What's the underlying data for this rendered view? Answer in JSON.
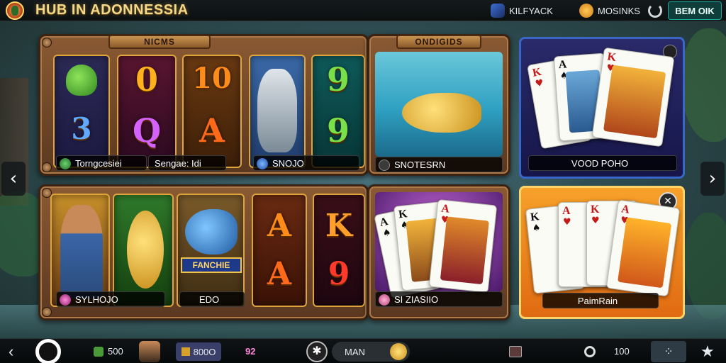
{
  "header": {
    "brand": "HUB IN ADONNESSIA",
    "account_label": "KILFYACK",
    "rewards_label": "MOSINKS",
    "cta_label": "BEM OIK"
  },
  "slots_top": {
    "title": "NICMS",
    "label_left": "Torngcesiei",
    "label_mid": "Sengae: Idi",
    "label_right": "SNOJO",
    "symbols": [
      "0",
      "10",
      "9",
      "3",
      "Q",
      "A",
      "9"
    ]
  },
  "fishing_tile": {
    "title": "ONDIGIDS",
    "label": "SNOTESRN"
  },
  "poker_tile": {
    "label": "VOOD POHO"
  },
  "slots_bottom": {
    "label_left": "SYLHOJO",
    "label_mid": "EDO",
    "banner": "FANCHIE",
    "symbols": [
      "A",
      "K",
      "A",
      "9"
    ]
  },
  "cards_tile_mid": {
    "label": "SI ZIASIIO"
  },
  "cards_tile_right": {
    "label": "PaimRain"
  },
  "card_ranks": [
    "K",
    "A",
    "K",
    "A",
    "K",
    "A",
    "K"
  ],
  "nav": {
    "prev": "‹",
    "next": "›"
  },
  "footer": {
    "coins": "500",
    "wallet": "800O",
    "level": "92",
    "spin_label": "MAN",
    "score": "100"
  },
  "icons": {
    "back": "chevron-left-icon",
    "home": "home-ring-icon",
    "settings": "gear-icon",
    "star": "star-icon",
    "search": "search-icon"
  },
  "colors": {
    "accent_gold": "#e0a43a",
    "cta_teal": "#1fa59a",
    "panel_blue": "#1c3a8c",
    "panel_orange": "#f08a1e"
  }
}
